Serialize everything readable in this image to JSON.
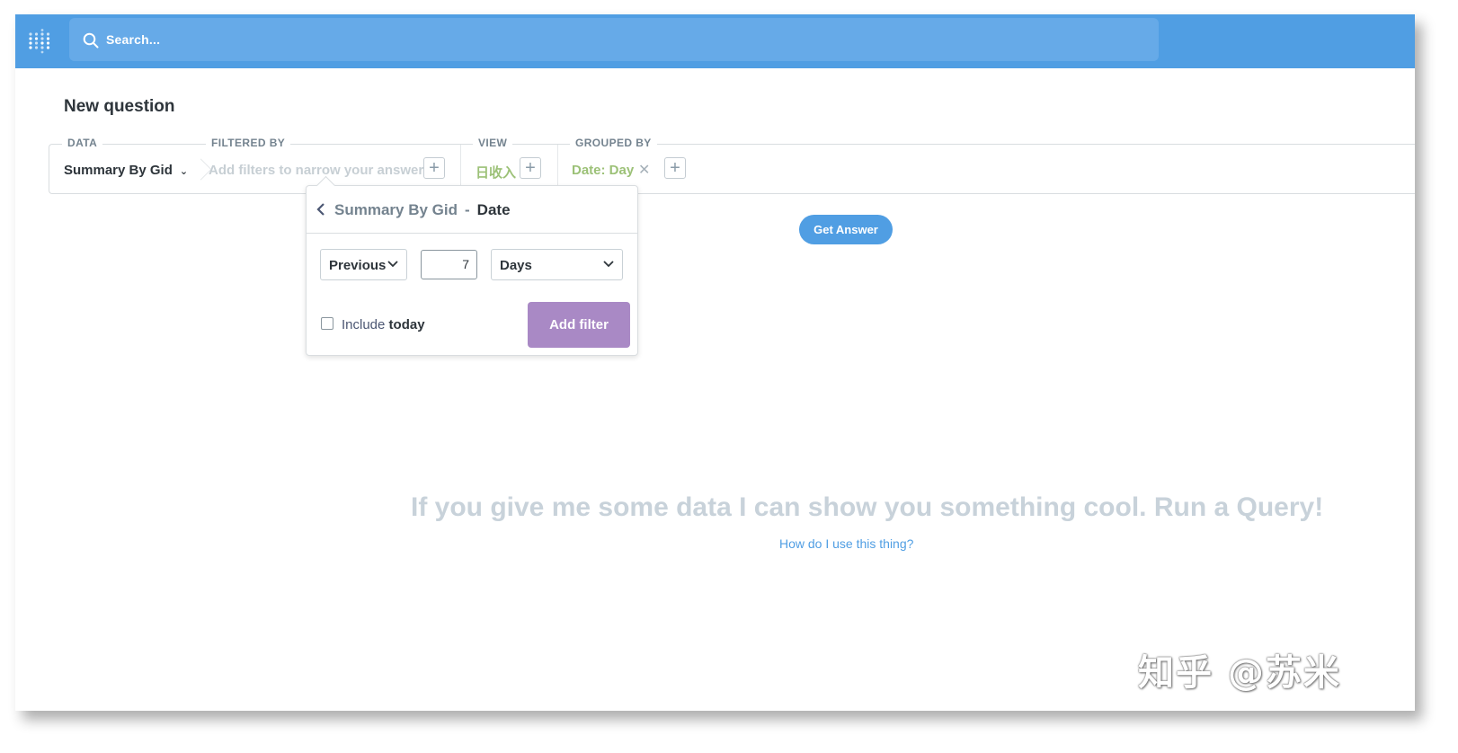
{
  "header": {
    "search_placeholder": "Search..."
  },
  "page": {
    "title": "New question"
  },
  "query_builder": {
    "data": {
      "label": "DATA",
      "value": "Summary By Gid"
    },
    "filter": {
      "label": "FILTERED BY",
      "placeholder": "Add filters to narrow your answer"
    },
    "view": {
      "label": "VIEW",
      "value": "日收入"
    },
    "group": {
      "label": "GROUPED BY",
      "value": "Date: Day"
    },
    "get_answer": "Get Answer"
  },
  "popover": {
    "table": "Summary By Gid",
    "separator": "-",
    "field": "Date",
    "operator": "Previous",
    "amount": "7",
    "unit": "Days",
    "include_prefix": "Include",
    "include_bold": "today",
    "include_checked": false,
    "add_filter": "Add filter"
  },
  "empty_state": {
    "message": "If you give me some data I can show you something cool. Run a Query!",
    "help_link": "How do I use this thing?"
  },
  "watermark": "知乎 @苏米",
  "colors": {
    "brand": "#509ee3",
    "filter_purple": "#a989c5",
    "green": "#9cc177"
  }
}
